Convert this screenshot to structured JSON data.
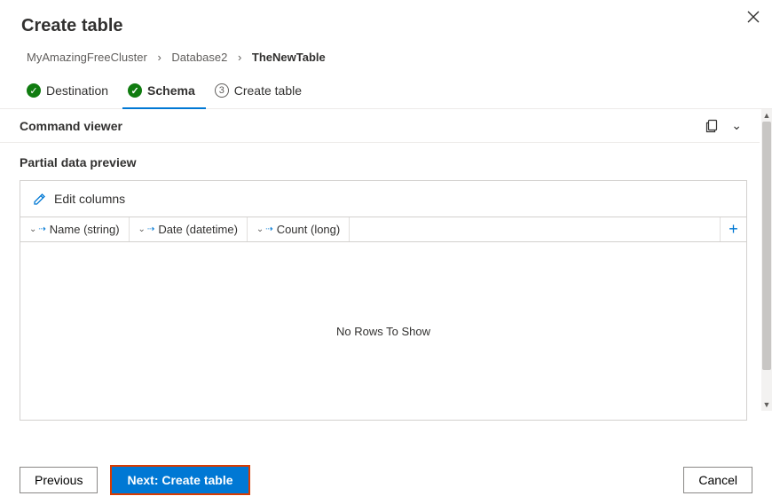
{
  "header": {
    "title": "Create table"
  },
  "breadcrumb": {
    "items": [
      "MyAmazingFreeCluster",
      "Database2",
      "TheNewTable"
    ]
  },
  "steps": [
    {
      "label": "Destination",
      "state": "done"
    },
    {
      "label": "Schema",
      "state": "active"
    },
    {
      "label": "Create table",
      "state": "pending",
      "num": "3"
    }
  ],
  "command_viewer": {
    "label": "Command viewer"
  },
  "preview": {
    "label": "Partial data preview",
    "edit_columns": "Edit columns",
    "columns": [
      {
        "name": "Name (string)"
      },
      {
        "name": "Date (datetime)"
      },
      {
        "name": "Count (long)"
      }
    ],
    "empty": "No Rows To Show"
  },
  "footer": {
    "previous": "Previous",
    "next": "Next: Create table",
    "cancel": "Cancel"
  }
}
